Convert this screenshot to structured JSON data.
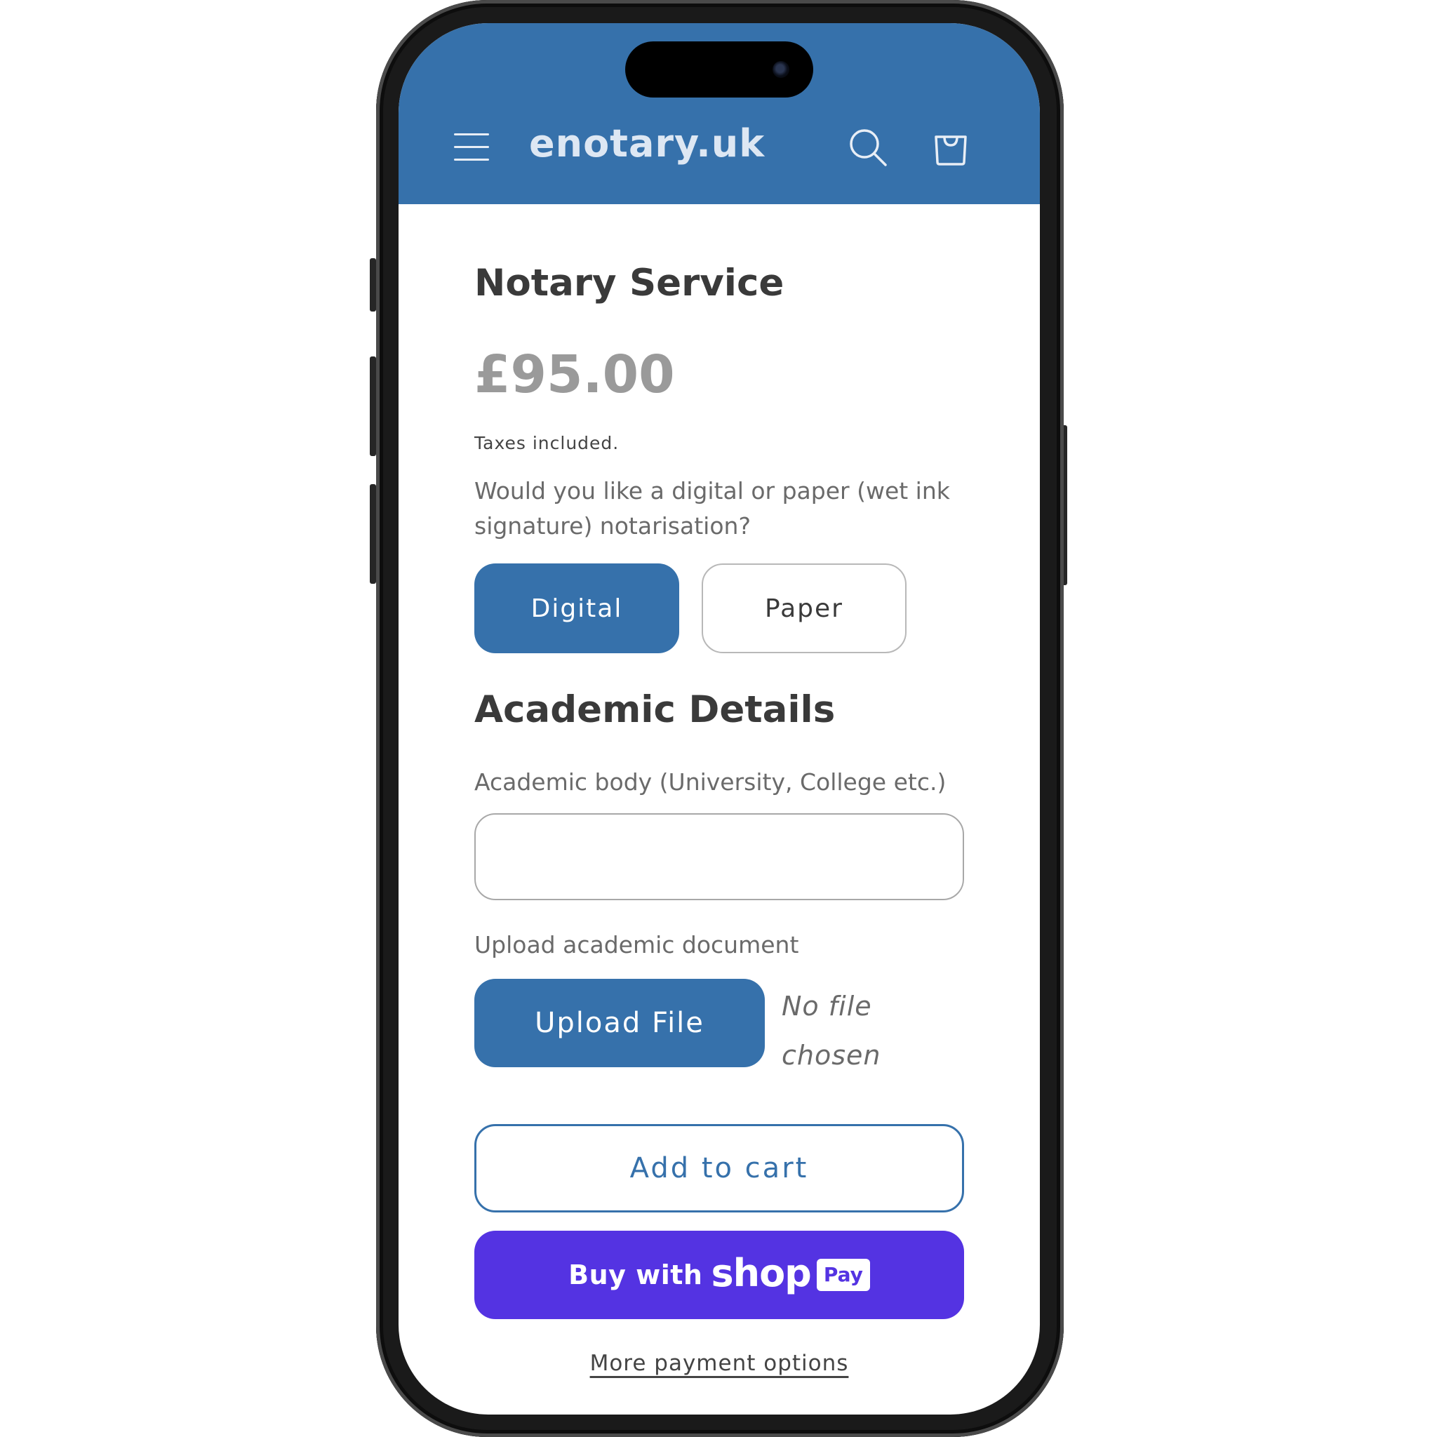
{
  "header": {
    "logo": "enotary.uk",
    "background_color": "#3671ab"
  },
  "product": {
    "title": "Notary Service",
    "price": "£95.00",
    "taxes_note": "Taxes included."
  },
  "options": {
    "question": "Would you like a digital or paper (wet ink signature) notarisation?",
    "digital_label": "Digital",
    "paper_label": "Paper",
    "selected": "Digital"
  },
  "academic": {
    "section_title": "Academic Details",
    "body_label": "Academic body (University, College etc.)",
    "body_value": "",
    "upload_label": "Upload academic document",
    "upload_button": "Upload File",
    "no_file_text": "No file chosen"
  },
  "actions": {
    "add_to_cart": "Add to cart",
    "buy_with": "Buy with",
    "shop_word": "shop",
    "pay_badge": "Pay",
    "more_options": "More payment options"
  },
  "colors": {
    "accent": "#3671ab",
    "shop_pay": "#5433e2"
  },
  "icons": [
    "hamburger-menu-icon",
    "search-icon",
    "shopping-bag-icon"
  ]
}
